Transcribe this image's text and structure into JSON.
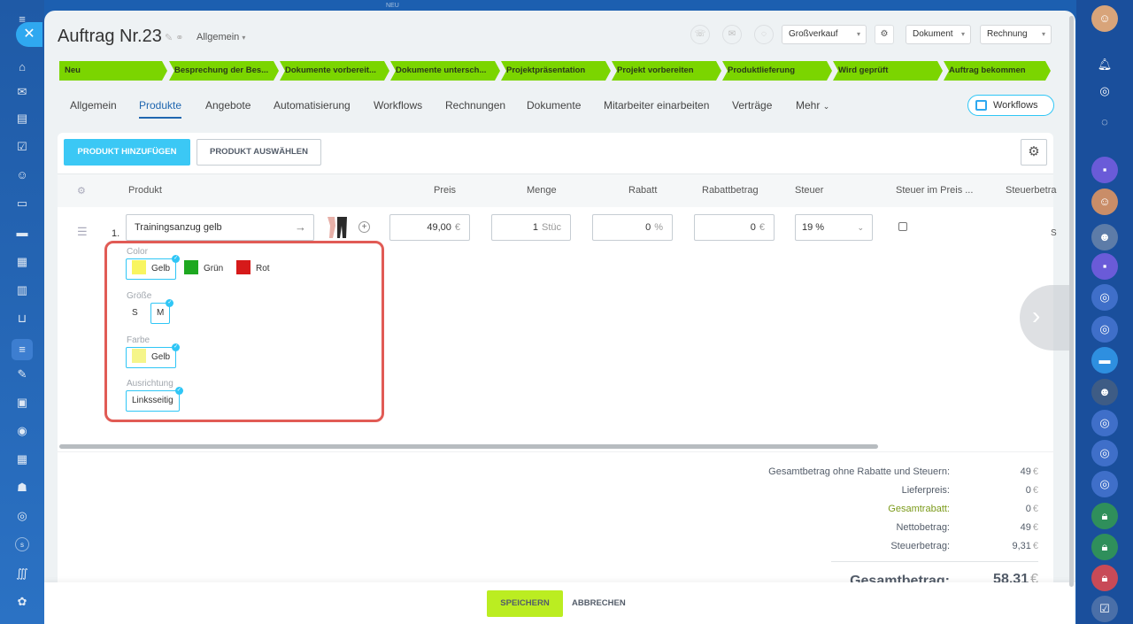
{
  "window": {
    "top_label": "NEU"
  },
  "header": {
    "title": "Auftrag Nr.23",
    "category": "Allgemein",
    "selects": [
      {
        "label": "Großverkauf"
      },
      {
        "label": "Dokument"
      },
      {
        "label": "Rechnung"
      }
    ]
  },
  "stages": [
    "Neu",
    "Besprechung der Bes...",
    "Dokumente vorbereit...",
    "Dokumente untersch...",
    "Projektpräsentation",
    "Projekt vorbereiten",
    "Produktlieferung",
    "Wird geprüft",
    "Auftrag bekommen"
  ],
  "tabs": [
    "Allgemein",
    "Produkte",
    "Angebote",
    "Automatisierung",
    "Workflows",
    "Rechnungen",
    "Dokumente",
    "Mitarbeiter einarbeiten",
    "Verträge",
    "Mehr"
  ],
  "workflows_button": "Workflows",
  "toolbar": {
    "add_product": "PRODUKT HINZUFÜGEN",
    "select_product": "PRODUKT AUSWÄHLEN"
  },
  "columns": [
    "Produkt",
    "Preis",
    "Menge",
    "Rabatt",
    "Rabattbetrag",
    "Steuer",
    "Steuer im Preis ...",
    "Steuerbetra"
  ],
  "row": {
    "number": "1.",
    "product": "Trainingsanzug gelb",
    "price": "49,00",
    "price_unit": "€",
    "quantity": "1",
    "quantity_unit": "Stüc",
    "discount": "0",
    "discount_unit": "%",
    "discount_amount": "0",
    "discount_amount_unit": "€",
    "tax": "19 %",
    "cut_value": "S"
  },
  "variants": {
    "color_label": "Color",
    "color_options": [
      {
        "label": "Gelb",
        "swatch": "#f8f560",
        "selected": true
      },
      {
        "label": "Grün",
        "swatch": "#1ea820",
        "selected": false
      },
      {
        "label": "Rot",
        "swatch": "#d61a1a",
        "selected": false
      }
    ],
    "size_label": "Größe",
    "size_options": [
      {
        "label": "S",
        "selected": false
      },
      {
        "label": "M",
        "selected": true
      }
    ],
    "farbe_label": "Farbe",
    "farbe_options": [
      {
        "label": "Gelb",
        "swatch": "#f5f58a",
        "selected": true
      }
    ],
    "ausrichtung_label": "Ausrichtung",
    "ausrichtung_options": [
      {
        "label": "Linksseitig",
        "selected": true
      }
    ]
  },
  "totals": {
    "lines": [
      {
        "label": "Gesamtbetrag ohne Rabatte und Steuern:",
        "value": "49"
      },
      {
        "label": "Lieferpreis:",
        "value": "0"
      },
      {
        "label": "Gesamtrabatt:",
        "value": "0"
      },
      {
        "label": "Nettobetrag:",
        "value": "49"
      },
      {
        "label": "Steuerbetrag:",
        "value": "9,31"
      }
    ],
    "currency": "€",
    "grand_label": "Gesamtbetrag:",
    "grand_value": "58,31"
  },
  "footer": {
    "save": "SPEICHERN",
    "cancel": "ABBRECHEN"
  },
  "colors": {
    "stage_green": "#7bd500",
    "primary_blue": "#3bc8f5",
    "save_green": "#bbed21",
    "highlight_red": "#e15b55",
    "active_tab": "#2067b0"
  }
}
